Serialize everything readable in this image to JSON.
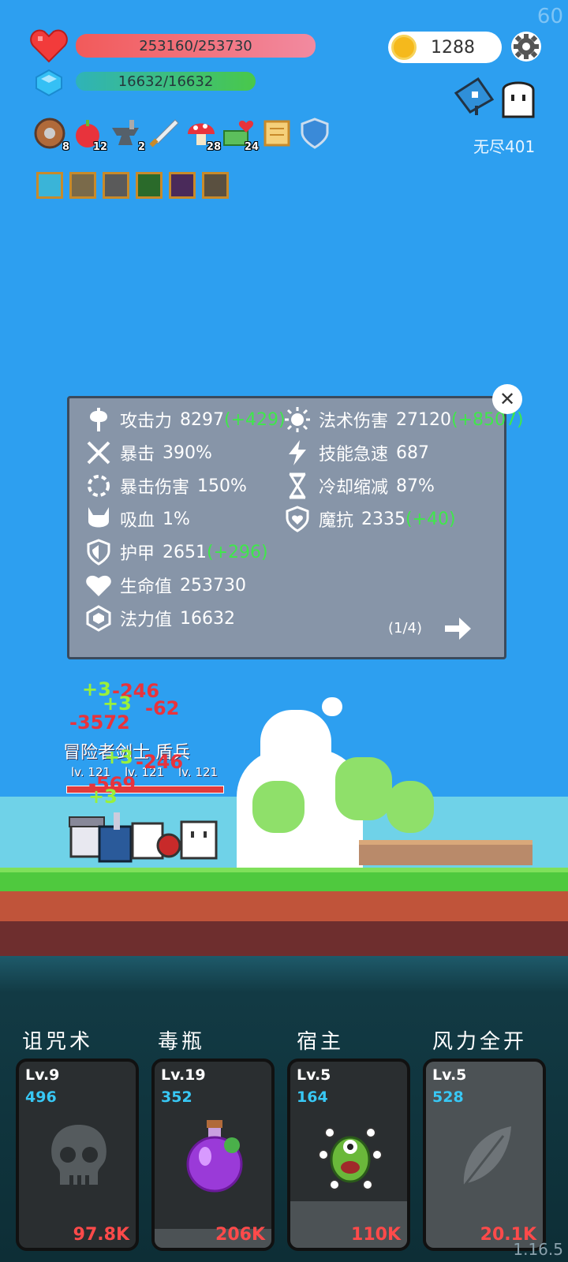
{
  "fps": "60",
  "version": "1.16.5",
  "player": {
    "hp": "253160/253730",
    "hp_fraction": 0.998,
    "mp": "16632/16632",
    "mp_fraction": 1.0
  },
  "coins": "1288",
  "mode_label": "无尽401",
  "items": [
    {
      "icon": "wooden-shield-icon",
      "count": "8"
    },
    {
      "icon": "apple-icon",
      "count": "12"
    },
    {
      "icon": "anvil-icon",
      "count": "2"
    },
    {
      "icon": "sword-icon",
      "count": ""
    },
    {
      "icon": "mushroom-icon",
      "count": "28"
    },
    {
      "icon": "money-heart-icon",
      "count": "24"
    },
    {
      "icon": "scroll-icon",
      "count": ""
    },
    {
      "icon": "shield-icon",
      "count": ""
    }
  ],
  "buffs": [
    "light-buff-icon",
    "armor-buff-icon",
    "armor-buff-icon",
    "poison-buff-icon",
    "curse-buff-icon",
    "armor-buff-icon"
  ],
  "stats_panel": {
    "left": [
      {
        "icon": "axe-icon",
        "label": "攻击力",
        "value": "8297",
        "bonus": "(+429)"
      },
      {
        "icon": "crit-icon",
        "label": "暴击",
        "value": "390%",
        "bonus": ""
      },
      {
        "icon": "crit-damage-icon",
        "label": "暴击伤害",
        "value": "150%",
        "bonus": ""
      },
      {
        "icon": "lifesteal-icon",
        "label": "吸血",
        "value": "1%",
        "bonus": ""
      },
      {
        "icon": "armor-icon",
        "label": "护甲",
        "value": "2651",
        "bonus": "(+296)"
      },
      {
        "icon": "heart-icon",
        "label": "生命值",
        "value": "253730",
        "bonus": ""
      },
      {
        "icon": "mana-gem-icon",
        "label": "法力值",
        "value": "16632",
        "bonus": ""
      }
    ],
    "right": [
      {
        "icon": "sun-icon",
        "label": "法术伤害",
        "value": "27120",
        "bonus": "(+8507)"
      },
      {
        "icon": "lightning-icon",
        "label": "技能急速",
        "value": "687",
        "bonus": ""
      },
      {
        "icon": "hourglass-icon",
        "label": "冷却缩减",
        "value": "87%",
        "bonus": ""
      },
      {
        "icon": "magic-resist-icon",
        "label": "魔抗",
        "value": "2335",
        "bonus": "(+40)"
      }
    ],
    "page": "(1/4)"
  },
  "heroes": {
    "names": "冒险者剑士 盾兵",
    "levels": [
      "lv. 121",
      "lv. 121",
      "lv. 121"
    ]
  },
  "damage_numbers": [
    {
      "text": "+3",
      "color": "green"
    },
    {
      "text": "-246",
      "color": "red"
    },
    {
      "text": "+3",
      "color": "green"
    },
    {
      "text": "-62",
      "color": "red"
    },
    {
      "text": "-3572",
      "color": "red"
    },
    {
      "text": "+3",
      "color": "green"
    },
    {
      "text": "-246",
      "color": "red"
    },
    {
      "text": "-569",
      "color": "red"
    },
    {
      "text": "+3",
      "color": "green"
    }
  ],
  "skills": [
    {
      "name": "诅咒术",
      "level": "Lv.9",
      "value": "496",
      "cost": "97.8K",
      "icon": "skull-icon",
      "fill": 0.0
    },
    {
      "name": "毒瓶",
      "level": "Lv.19",
      "value": "352",
      "cost": "206K",
      "icon": "poison-bottle-icon",
      "fill": 0.1
    },
    {
      "name": "宿主",
      "level": "Lv.5",
      "value": "164",
      "cost": "110K",
      "icon": "eyeball-monster-icon",
      "fill": 0.25
    },
    {
      "name": "风力全开",
      "level": "Lv.5",
      "value": "528",
      "cost": "20.1K",
      "icon": "feather-icon",
      "fill": 1.0
    }
  ],
  "colors": {
    "sky": "#2d9ff0",
    "hp_bar": "#f25a5a",
    "mp_bar": "#49c84a",
    "bonus_text": "#3fe84a",
    "cost_text": "#ff4a4a",
    "skill_value": "#38c8f5"
  }
}
